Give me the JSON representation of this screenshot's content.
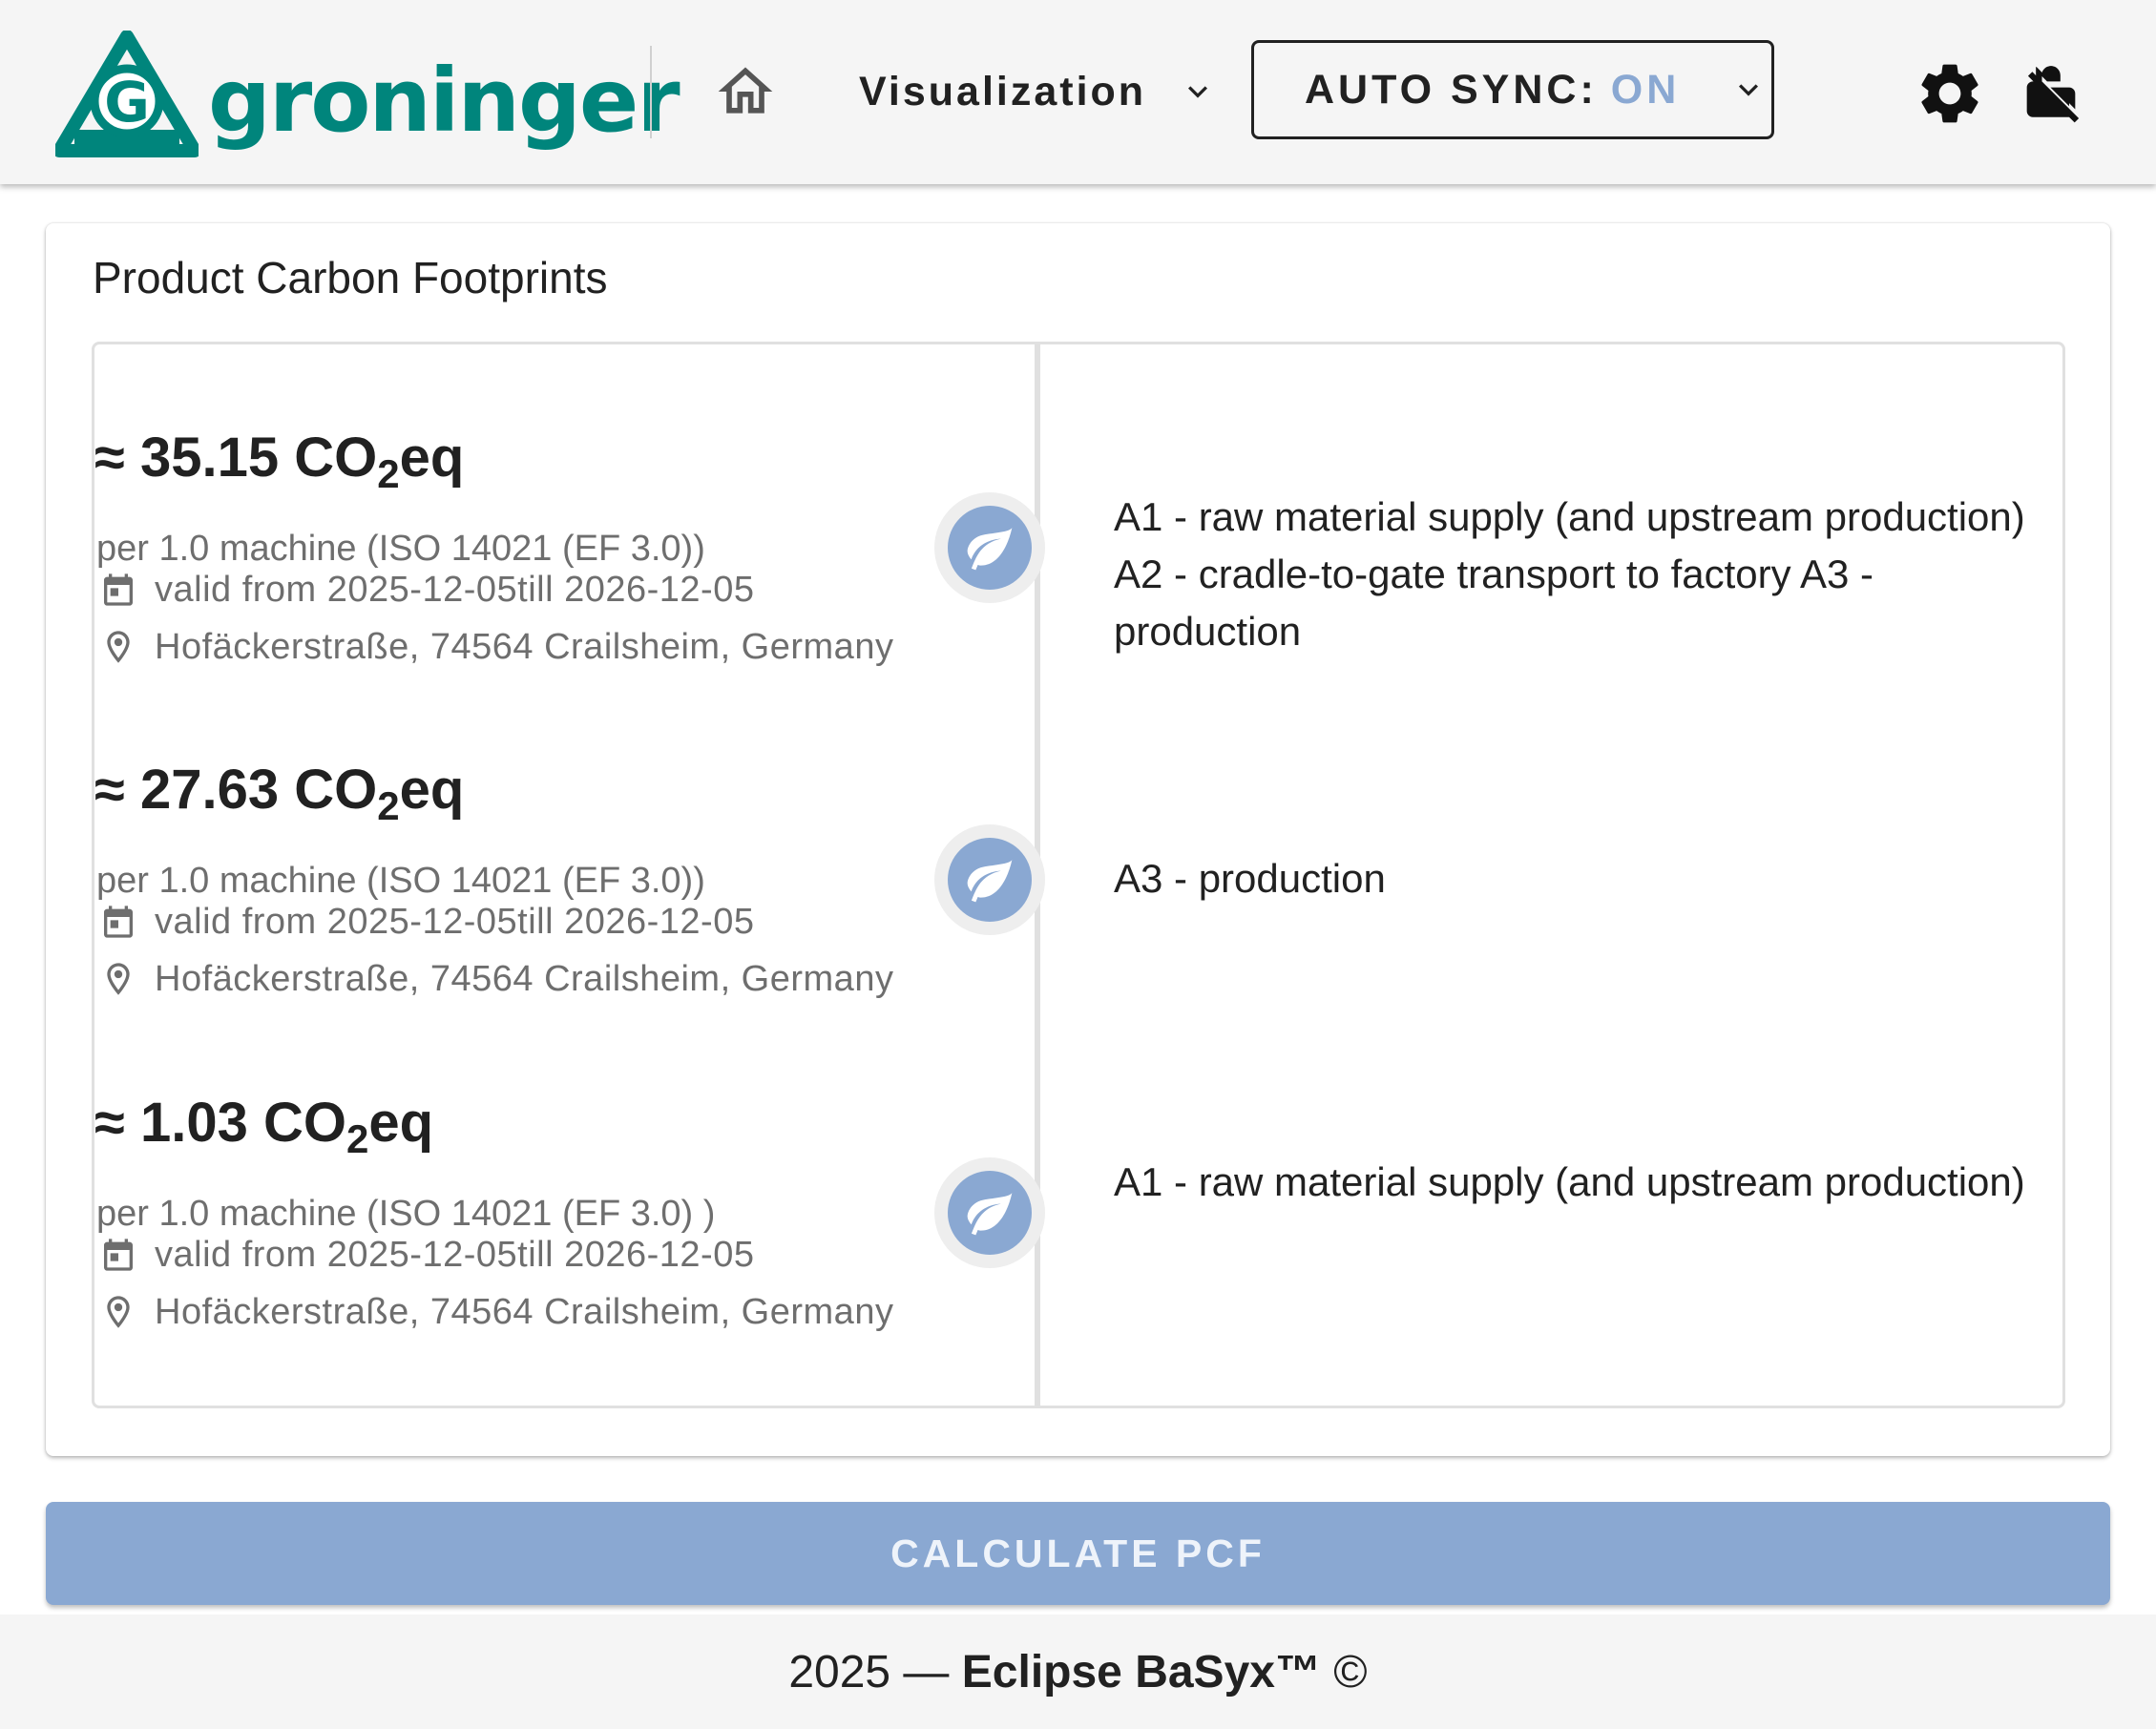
{
  "header": {
    "logo_text": "groninger",
    "logo_letter": "G",
    "visualization_label": "Visualization",
    "auto_sync_label": "AUTO SYNC:",
    "auto_sync_value": "ON",
    "icons": {
      "home": "home-icon",
      "visualization_dropdown": "chevron-down-icon",
      "auto_sync_dropdown": "chevron-down-icon",
      "settings": "gear-icon",
      "lock": "lock-off-icon"
    }
  },
  "card": {
    "title": "Product Carbon Footprints",
    "entries": [
      {
        "approx": "≈",
        "value": "35.15",
        "co": "CO",
        "sub": "2",
        "eq": "eq",
        "unit": "per 1.0 machine (ISO 14021 (EF 3.0))",
        "validity": "valid from 2025-12-05till 2026-12-05",
        "address": "Hofäckerstraße, 74564 Crailsheim, Germany",
        "stages": "A1 - raw material supply (and upstream production) A2 - cradle-to-gate transport to factory A3 - production"
      },
      {
        "approx": "≈",
        "value": "27.63",
        "co": "CO",
        "sub": "2",
        "eq": "eq",
        "unit": "per 1.0 machine (ISO 14021 (EF 3.0))",
        "validity": "valid from 2025-12-05till 2026-12-05",
        "address": "Hofäckerstraße, 74564 Crailsheim, Germany",
        "stages": "A3 - production"
      },
      {
        "approx": "≈",
        "value": "1.03",
        "co": "CO",
        "sub": "2",
        "eq": "eq",
        "unit": "per 1.0 machine (ISO 14021 (EF 3.0) )",
        "validity": "valid from 2025-12-05till 2026-12-05",
        "address": "Hofäckerstraße, 74564 Crailsheim, Germany",
        "stages": "A1 - raw material supply (and upstream production)"
      }
    ],
    "icons": {
      "timeline_dot": "leaf-icon",
      "validity": "calendar-icon",
      "address": "map-marker-icon"
    }
  },
  "calculate_button": "CALCULATE PCF",
  "footer": {
    "year_prefix": "2025 — ",
    "brand": "Eclipse BaSyx™",
    "suffix": " ©"
  },
  "colors": {
    "brand_green": "#00857c",
    "accent_blue": "#8aa8d2",
    "header_bg": "#f5f5f5",
    "muted_text": "#6e6e6e"
  }
}
